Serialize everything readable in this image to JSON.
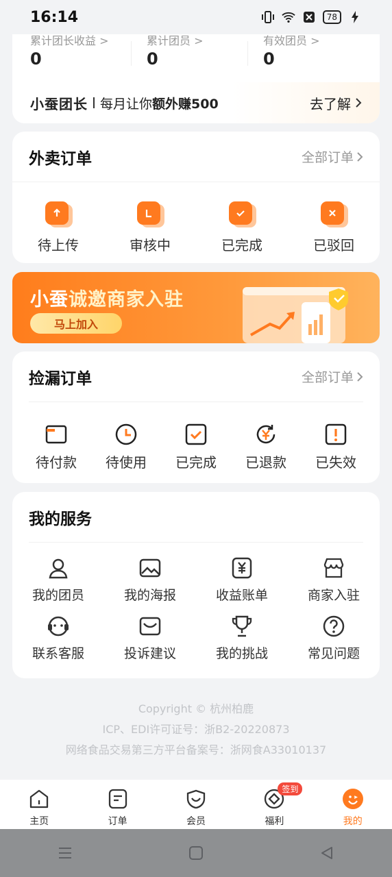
{
  "status": {
    "time": "16:14",
    "battery": "78"
  },
  "stats": {
    "items": [
      {
        "label": "累计团长收益 >",
        "value": "0"
      },
      {
        "label": "累计团员 >",
        "value": "0"
      },
      {
        "label": "有效团员 >",
        "value": "0"
      }
    ],
    "promo": {
      "brand": "小蚕团长",
      "text_prefix": "每月让你",
      "text_highlight": "额外赚500",
      "link": "去了解"
    }
  },
  "waimai": {
    "title": "外卖订单",
    "more": "全部订单",
    "items": [
      {
        "label": "待上传",
        "icon": "upload-icon"
      },
      {
        "label": "审核中",
        "icon": "review-icon"
      },
      {
        "label": "已完成",
        "icon": "check-icon"
      },
      {
        "label": "已驳回",
        "icon": "reject-icon"
      }
    ]
  },
  "banner": {
    "title_a": "小蚕",
    "title_b": "诚邀商家入驻",
    "button": "马上加入"
  },
  "jianlou": {
    "title": "捡漏订单",
    "more": "全部订单",
    "items": [
      {
        "label": "待付款",
        "icon": "wallet-icon"
      },
      {
        "label": "待使用",
        "icon": "clock-icon"
      },
      {
        "label": "已完成",
        "icon": "check-square-icon"
      },
      {
        "label": "已退款",
        "icon": "refund-icon"
      },
      {
        "label": "已失效",
        "icon": "expired-icon"
      }
    ]
  },
  "services": {
    "title": "我的服务",
    "items": [
      {
        "label": "我的团员",
        "icon": "user-icon"
      },
      {
        "label": "我的海报",
        "icon": "image-icon"
      },
      {
        "label": "收益账单",
        "icon": "bill-icon"
      },
      {
        "label": "商家入驻",
        "icon": "store-icon"
      },
      {
        "label": "联系客服",
        "icon": "headset-icon"
      },
      {
        "label": "投诉建议",
        "icon": "mail-icon"
      },
      {
        "label": "我的挑战",
        "icon": "trophy-icon"
      },
      {
        "label": "常见问题",
        "icon": "question-icon"
      }
    ]
  },
  "footer": {
    "copyright": "Copyright © 杭州柏鹿",
    "icp": "ICP、EDI许可证号：浙B2-20220873",
    "filing": "网络食品交易第三方平台备案号：浙网食A33010137"
  },
  "tabs": [
    {
      "label": "主页",
      "icon": "home-icon"
    },
    {
      "label": "订单",
      "icon": "orders-icon"
    },
    {
      "label": "会员",
      "icon": "member-icon"
    },
    {
      "label": "福利",
      "icon": "welfare-icon",
      "badge": "签到"
    },
    {
      "label": "我的",
      "icon": "profile-icon",
      "active": true
    }
  ],
  "colors": {
    "accent": "#ff7a1f",
    "badge": "#f34a3c"
  }
}
